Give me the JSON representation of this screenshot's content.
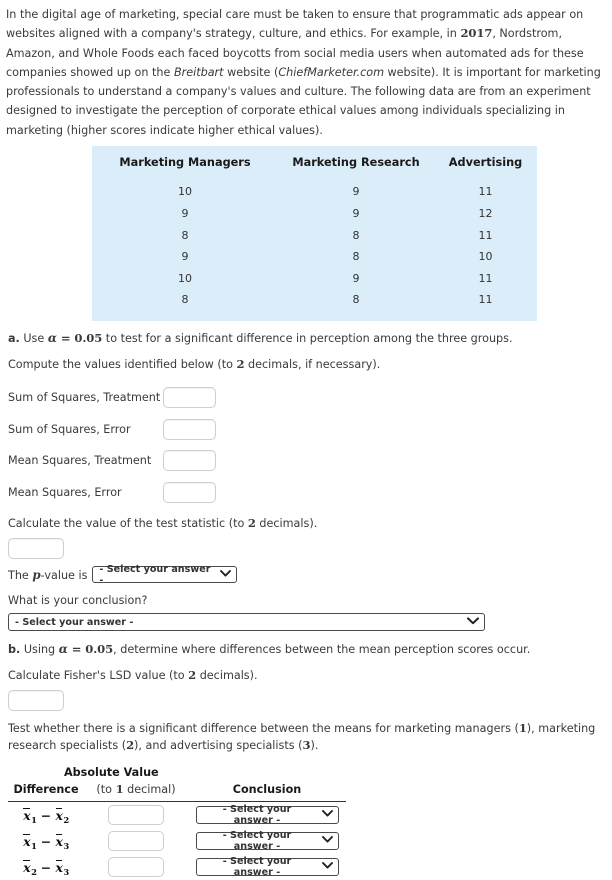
{
  "intro": {
    "p1_a": "In the digital age of marketing, special care must be taken to ensure that programmatic ads appear on websites aligned with a company's strategy, culture, and ethics. For example, in ",
    "year": "2017",
    "p1_b": ", Nordstrom, Amazon, and Whole Foods each faced boycotts from social media users when automated ads for these companies showed up on the ",
    "italic1": "Breitbart",
    "p1_c": " website (",
    "italic2": "ChiefMarketer.com",
    "p1_d": " website). It is important for marketing professionals to understand a company's values and culture. The following data are from an experiment designed to investigate the perception of corporate ethical values among individuals specializing in marketing (higher scores indicate higher ethical values)."
  },
  "data_table": {
    "headers": [
      "Marketing Managers",
      "Marketing Research",
      "Advertising"
    ],
    "rows": [
      [
        "10",
        "9",
        "11"
      ],
      [
        "9",
        "9",
        "12"
      ],
      [
        "8",
        "8",
        "11"
      ],
      [
        "9",
        "8",
        "10"
      ],
      [
        "10",
        "9",
        "11"
      ],
      [
        "8",
        "8",
        "11"
      ]
    ]
  },
  "part_a": {
    "prefix": "a.",
    "line1_pre": " Use ",
    "alpha": "α",
    "eq": " = ",
    "alpha_value": "0.05",
    "line1_post": " to test for a significant difference in perception among the three groups.",
    "line2_pre": "Compute the values identified below (to ",
    "decimals": "2",
    "line2_post": " decimals, if necessary).",
    "fields": [
      {
        "label": "Sum of Squares, Treatment",
        "value": ""
      },
      {
        "label": "Sum of Squares, Error",
        "value": ""
      },
      {
        "label": "Mean Squares, Treatment",
        "value": ""
      },
      {
        "label": "Mean Squares, Error",
        "value": ""
      }
    ],
    "test_stat_pre": "Calculate the value of the test statistic (to ",
    "test_stat_decimals": "2",
    "test_stat_post": " decimals).",
    "test_stat_value": "",
    "pvalue_pre": "The ",
    "pvalue_p": "p",
    "pvalue_post": "-value is",
    "pvalue_select": "- Select your answer -",
    "conclusion_question": "What is your conclusion?",
    "conclusion_select": "- Select your answer -"
  },
  "part_b": {
    "prefix": "b.",
    "line1_pre": " Using ",
    "alpha": "α",
    "eq": " = ",
    "alpha_value": "0.05",
    "line1_post": ", determine where differences between the mean perception scores occur.",
    "lsd_pre": "Calculate Fisher's LSD value (to ",
    "lsd_decimals": "2",
    "lsd_post": " decimals).",
    "lsd_value": "",
    "test_line_pre": "Test whether there is a significant difference between the means for marketing managers (",
    "g1": "1",
    "test_line_mid1": "), marketing research specialists (",
    "g2": "2",
    "test_line_mid2": "), and advertising specialists (",
    "g3": "3",
    "test_line_end": ")."
  },
  "comparison_table": {
    "abs_header": "Absolute Value",
    "headers": [
      "Difference",
      "(to 1 decimal)",
      "Conclusion"
    ],
    "decimal_pre": "(to ",
    "decimal_num": "1",
    "decimal_post": " decimal)",
    "rows": [
      {
        "sub1": "1",
        "sub2": "2",
        "value": "",
        "conclusion": "- Select your answer -"
      },
      {
        "sub1": "1",
        "sub2": "3",
        "value": "",
        "conclusion": "- Select your answer -"
      },
      {
        "sub1": "2",
        "sub2": "3",
        "value": "",
        "conclusion": "- Select your answer -"
      }
    ],
    "minus": "−",
    "xvar": "x"
  },
  "icons": {
    "chevron": "⌄"
  },
  "colors": {
    "table_bg": "#dcedfa",
    "text": "#3a3a3a",
    "border_dark": "#4a4a4a",
    "border_light": "#cfcfcf"
  }
}
